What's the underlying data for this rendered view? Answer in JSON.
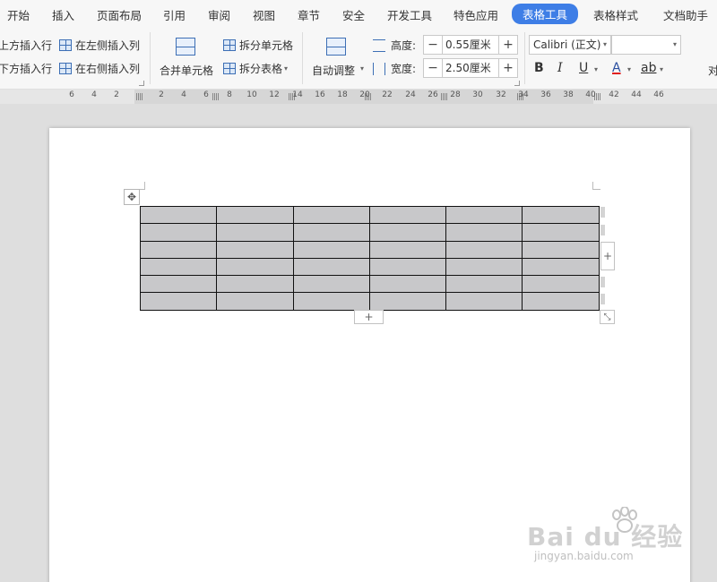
{
  "menu": {
    "tabs": [
      {
        "label": "开始"
      },
      {
        "label": "插入"
      },
      {
        "label": "页面布局"
      },
      {
        "label": "引用"
      },
      {
        "label": "审阅"
      },
      {
        "label": "视图"
      },
      {
        "label": "章节"
      },
      {
        "label": "安全"
      },
      {
        "label": "开发工具"
      },
      {
        "label": "特色应用"
      },
      {
        "label": "表格工具",
        "active": true
      },
      {
        "label": "表格样式"
      },
      {
        "label": "文档助手"
      }
    ]
  },
  "ribbon": {
    "insert_row_above": "上方插入行",
    "insert_row_below": "下方插入行",
    "insert_col_left": "在左侧插入列",
    "insert_col_right": "在右侧插入列",
    "merge_cells": "合并单元格",
    "split_cells": "拆分单元格",
    "split_table": "拆分表格",
    "auto_fit": "自动调整",
    "height_label": "高度:",
    "height_value": "0.55厘米",
    "width_label": "宽度:",
    "width_value": "2.50厘米",
    "font_name": "Calibri (正文)",
    "font_size": "",
    "bold": "B",
    "italic": "I",
    "underline": "U",
    "font_color": "A",
    "highlight": "ab",
    "cut_off_label": "对"
  },
  "ruler": {
    "ticks": [
      "6",
      "4",
      "2",
      "2",
      "4",
      "6",
      "8",
      "10",
      "12",
      "14",
      "16",
      "18",
      "20",
      "22",
      "24",
      "26",
      "28",
      "30",
      "32",
      "34",
      "36",
      "38",
      "40",
      "42",
      "44",
      "46"
    ]
  },
  "table": {
    "rows": 6,
    "cols": 6,
    "cell_color": "#c8c8ca",
    "add_col_symbol": "+",
    "add_row_symbol": "+",
    "move_symbol": "✥",
    "resize_symbol": "⤡"
  },
  "watermark": {
    "text": "Bai du 经验",
    "url": "jingyan.baidu.com"
  },
  "colors": {
    "accent": "#3e7ee6",
    "icon_blue": "#3d6fb5"
  }
}
